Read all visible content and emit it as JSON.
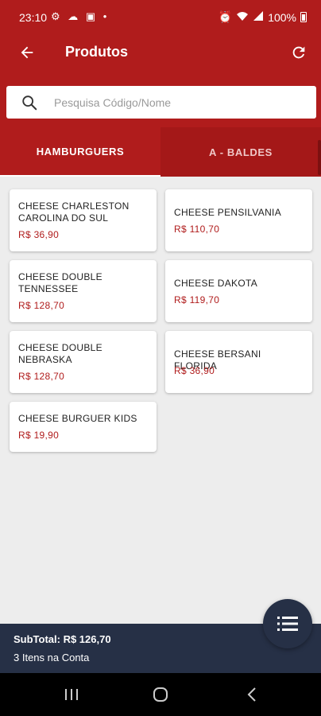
{
  "status_bar": {
    "time": "23:10",
    "notification_icons": "⚙ ☁ ▣ •",
    "battery": "100%"
  },
  "app_bar": {
    "title": "Produtos",
    "back_icon": "arrow-left-icon",
    "refresh_icon": "refresh-icon"
  },
  "search": {
    "placeholder": "Pesquisa Código/Nome",
    "value": ""
  },
  "tabs": [
    {
      "label": "HAMBURGUERS",
      "selected": true
    },
    {
      "label": "A - BALDES",
      "selected": false
    }
  ],
  "products": [
    {
      "name": "CHEESE CHARLESTON CAROLINA DO SUL",
      "price": "R$ 36,90"
    },
    {
      "name": "CHEESE PENSILVANIA",
      "price": "R$ 110,70"
    },
    {
      "name": "CHEESE DOUBLE TENNESSEE",
      "price": "R$ 128,70"
    },
    {
      "name": "CHEESE DAKOTA",
      "price": "R$ 119,70"
    },
    {
      "name": "CHEESE DOUBLE NEBRASKA",
      "price": "R$ 128,70"
    },
    {
      "name": "CHEESE BERSANI FLORIDA",
      "price": "R$ 36,90"
    },
    {
      "name": "CHEESE BURGUER KIDS",
      "price": "R$ 19,90"
    }
  ],
  "footer": {
    "subtotal": "SubTotal: R$ 126,70",
    "items_count": "3 Itens na Conta"
  },
  "fab_icon": "list-icon",
  "colors": {
    "primary": "#b01c1c",
    "footer_bg": "#263046",
    "background": "#ededed"
  }
}
